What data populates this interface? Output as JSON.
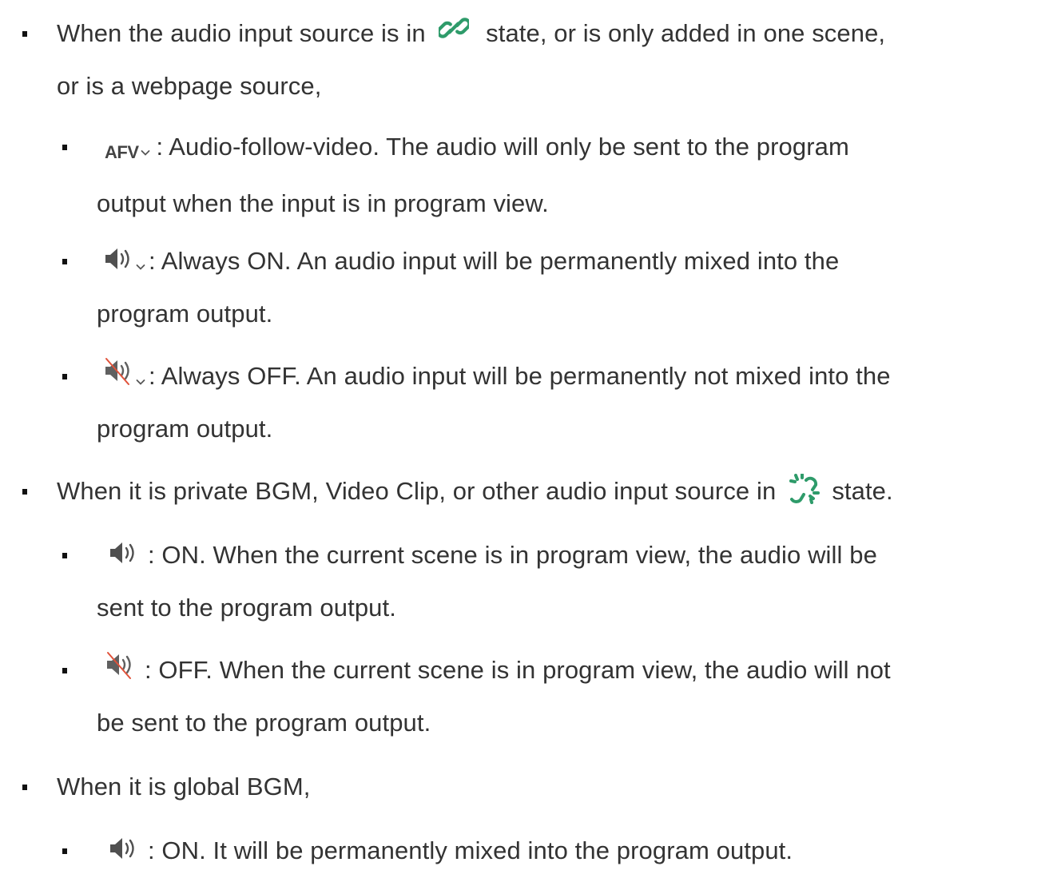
{
  "items": [
    {
      "level": 1,
      "parts": [
        "When the audio input source is in",
        "state, or is only added in one scene,",
        "or is a webpage source,"
      ]
    },
    {
      "level": 2,
      "icon_label": "AFV",
      "parts": [
        ": Audio-follow-video. The audio will only be sent to the program",
        "output when the input is in program view."
      ]
    },
    {
      "level": 2,
      "parts": [
        ": Always ON. An audio input will be permanently mixed into the",
        "program output."
      ]
    },
    {
      "level": 2,
      "parts": [
        ": Always OFF. An audio input will be permanently not mixed into the",
        "program output."
      ]
    },
    {
      "level": 1,
      "parts": [
        "When it is private BGM, Video Clip, or other audio input source in",
        "state."
      ]
    },
    {
      "level": 2,
      "parts": [
        ": ON. When the current scene is in program view, the audio will be",
        "sent to the program output."
      ]
    },
    {
      "level": 2,
      "parts": [
        ": OFF. When the current scene is in program view, the audio will not",
        "be sent to the program output."
      ]
    },
    {
      "level": 1,
      "parts": [
        "When it is global BGM,"
      ]
    },
    {
      "level": 2,
      "parts": [
        ": ON. It will be permanently mixed into the program output."
      ]
    }
  ],
  "icons": {
    "linked": "link-icon",
    "unlinked": "unlink-icon",
    "speaker": "speaker-icon",
    "muted": "speaker-muted-icon",
    "chevron": "chevron-down-icon"
  },
  "colors": {
    "text": "#333333",
    "accent_green": "#2e9b6a",
    "icon_gray": "#505050",
    "mute_red": "#e0523a"
  }
}
